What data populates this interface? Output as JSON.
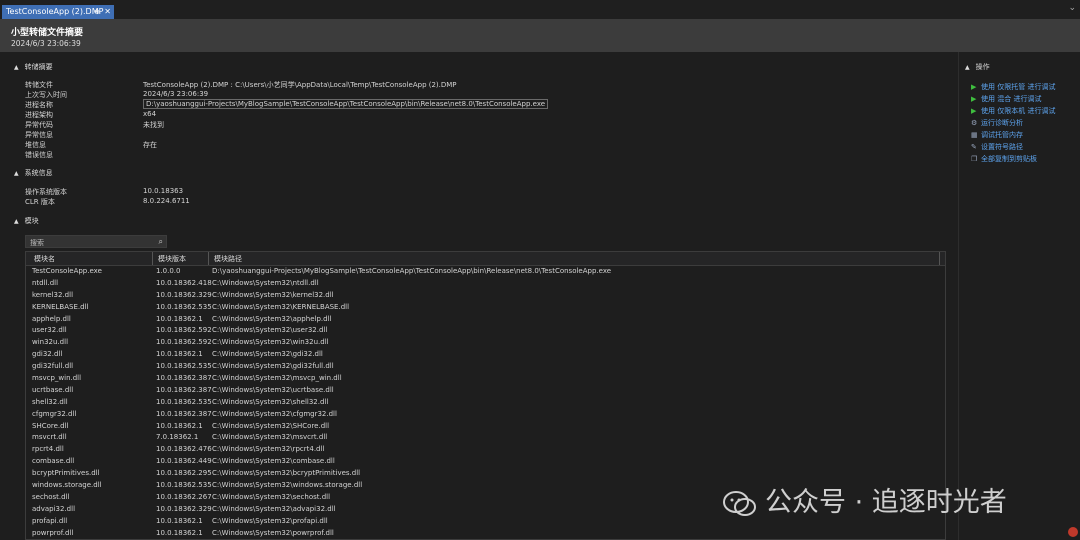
{
  "tab": {
    "label": "TestConsoleApp (2).DMP",
    "pin": "⊕",
    "close": "✕",
    "overflow": "⌄"
  },
  "header": {
    "title": "小型转储文件摘要",
    "subtitle": "2024/6/3 23:06:39"
  },
  "dump_summary": {
    "section": "转储摘要",
    "rows": [
      {
        "label": "转储文件",
        "value": "TestConsoleApp (2).DMP : C:\\Users\\小艺同学\\AppData\\Local\\Temp\\TestConsoleApp (2).DMP"
      },
      {
        "label": "上次写入时间",
        "value": "2024/6/3 23:06:39"
      },
      {
        "label": "进程名称",
        "value": "D:\\yaoshuanggui-Projects\\MyBlogSample\\TestConsoleApp\\TestConsoleApp\\bin\\Release\\net8.0\\TestConsoleApp.exe"
      },
      {
        "label": "进程架构",
        "value": "x64"
      },
      {
        "label": "异常代码",
        "value": "未找到"
      },
      {
        "label": "异常信息",
        "value": ""
      },
      {
        "label": "堆信息",
        "value": "存在"
      },
      {
        "label": "错误信息",
        "value": ""
      }
    ]
  },
  "system_info": {
    "section": "系统信息",
    "rows": [
      {
        "label": "操作系统版本",
        "value": "10.0.18363"
      },
      {
        "label": "CLR 版本",
        "value": "8.0.224.6711"
      }
    ]
  },
  "modules": {
    "section": "模块",
    "search_placeholder": "搜索",
    "columns": [
      "模块名",
      "模块版本",
      "模块路径"
    ],
    "rows": [
      [
        "TestConsoleApp.exe",
        "1.0.0.0",
        "D:\\yaoshuanggui-Projects\\MyBlogSample\\TestConsoleApp\\TestConsoleApp\\bin\\Release\\net8.0\\TestConsoleApp.exe"
      ],
      [
        "ntdll.dll",
        "10.0.18362.418",
        "C:\\Windows\\System32\\ntdll.dll"
      ],
      [
        "kernel32.dll",
        "10.0.18362.329",
        "C:\\Windows\\System32\\kernel32.dll"
      ],
      [
        "KERNELBASE.dll",
        "10.0.18362.535",
        "C:\\Windows\\System32\\KERNELBASE.dll"
      ],
      [
        "apphelp.dll",
        "10.0.18362.1",
        "C:\\Windows\\System32\\apphelp.dll"
      ],
      [
        "user32.dll",
        "10.0.18362.592",
        "C:\\Windows\\System32\\user32.dll"
      ],
      [
        "win32u.dll",
        "10.0.18362.592",
        "C:\\Windows\\System32\\win32u.dll"
      ],
      [
        "gdi32.dll",
        "10.0.18362.1",
        "C:\\Windows\\System32\\gdi32.dll"
      ],
      [
        "gdi32full.dll",
        "10.0.18362.535",
        "C:\\Windows\\System32\\gdi32full.dll"
      ],
      [
        "msvcp_win.dll",
        "10.0.18362.387",
        "C:\\Windows\\System32\\msvcp_win.dll"
      ],
      [
        "ucrtbase.dll",
        "10.0.18362.387",
        "C:\\Windows\\System32\\ucrtbase.dll"
      ],
      [
        "shell32.dll",
        "10.0.18362.535",
        "C:\\Windows\\System32\\shell32.dll"
      ],
      [
        "cfgmgr32.dll",
        "10.0.18362.387",
        "C:\\Windows\\System32\\cfgmgr32.dll"
      ],
      [
        "SHCore.dll",
        "10.0.18362.1",
        "C:\\Windows\\System32\\SHCore.dll"
      ],
      [
        "msvcrt.dll",
        "7.0.18362.1",
        "C:\\Windows\\System32\\msvcrt.dll"
      ],
      [
        "rpcrt4.dll",
        "10.0.18362.476",
        "C:\\Windows\\System32\\rpcrt4.dll"
      ],
      [
        "combase.dll",
        "10.0.18362.449",
        "C:\\Windows\\System32\\combase.dll"
      ],
      [
        "bcryptPrimitives.dll",
        "10.0.18362.295",
        "C:\\Windows\\System32\\bcryptPrimitives.dll"
      ],
      [
        "windows.storage.dll",
        "10.0.18362.535",
        "C:\\Windows\\System32\\windows.storage.dll"
      ],
      [
        "sechost.dll",
        "10.0.18362.267",
        "C:\\Windows\\System32\\sechost.dll"
      ],
      [
        "advapi32.dll",
        "10.0.18362.329",
        "C:\\Windows\\System32\\advapi32.dll"
      ],
      [
        "profapi.dll",
        "10.0.18362.1",
        "C:\\Windows\\System32\\profapi.dll"
      ],
      [
        "powrprof.dll",
        "10.0.18362.1",
        "C:\\Windows\\System32\\powrprof.dll"
      ]
    ]
  },
  "actions": {
    "title": "操作",
    "items": [
      {
        "label": "使用 仅限托管 进行调试",
        "icon": "play-icon"
      },
      {
        "label": "使用 混合 进行调试",
        "icon": "play-icon"
      },
      {
        "label": "使用 仅限本机 进行调试",
        "icon": "play-icon"
      },
      {
        "label": "运行诊断分析",
        "icon": "diagnostics-icon"
      },
      {
        "label": "调试托管内存",
        "icon": "memory-icon"
      },
      {
        "label": "设置符号路径",
        "icon": "symbol-path-icon"
      },
      {
        "label": "全部复制到剪贴板",
        "icon": "copy-icon"
      }
    ]
  },
  "watermark": {
    "text": "公众号 · 追逐时光者",
    "icon": "wechat-icon"
  }
}
